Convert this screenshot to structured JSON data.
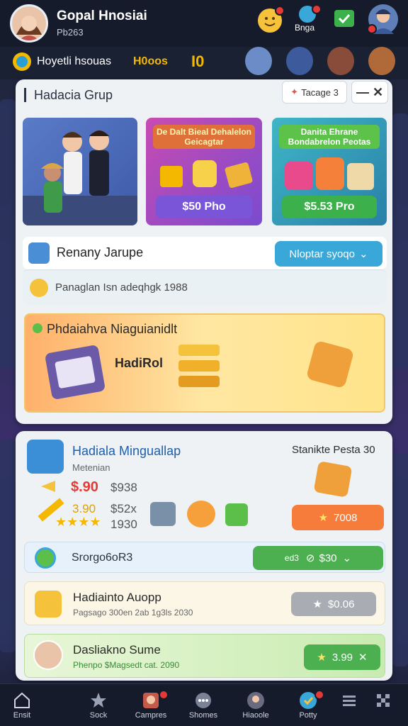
{
  "header": {
    "title": "Gopal Hnosiai",
    "subtitle": "Pb263",
    "icons": [
      {
        "name": "emoji-icon",
        "label": ""
      },
      {
        "name": "bell-icon",
        "label": "Bnga"
      },
      {
        "name": "ticket-icon",
        "label": ""
      },
      {
        "name": "user-icon",
        "label": ""
      }
    ]
  },
  "subbar": {
    "name": "Hoyetli hsouas",
    "coins": "H0oos",
    "count": "I0"
  },
  "panel1": {
    "title": "Hadacia Grup",
    "tab": "Tacage 3",
    "cards": [
      {
        "title": "",
        "button": ""
      },
      {
        "title": "De Dalt Bieal Dehalelon Geicagtar",
        "button": "$50 Pho"
      },
      {
        "title": "Danita Ehrane Bondabrelon Peotas",
        "button": "$5.53 Pro"
      }
    ],
    "row1": {
      "label": "Renany Jarupe",
      "button": "Nloptar syoqo"
    },
    "row2": {
      "label": "Panaglan Isn adeqhgk 1988"
    },
    "banner": {
      "title": "Phdaiahva Niaguianidlt",
      "label": "HadiRol"
    }
  },
  "panel2": {
    "title": "Hadiala Minguallap",
    "subtitle": "Metenian",
    "right_label": "Stanikte Pesta 30",
    "price_old": "$.90",
    "price_line1": "$938",
    "price_alt": "3.90",
    "price_line2": "$52x",
    "price_line3": "1930",
    "orange_btn": "7008",
    "row_a": {
      "label": "Srorgo6oR3",
      "small": "ed3",
      "button": "$30"
    },
    "row_b": {
      "title": "Hadiainto Auopp",
      "sub": "Pagsago 300en 2ab 1g3ls 2030",
      "button": "$0.06"
    },
    "row_c": {
      "title": "Dasliakno Sume",
      "sub": "Phenpo $Magsedt cat. 2090",
      "button": "3.99"
    }
  },
  "nav": [
    {
      "name": "home",
      "label": "Ensit"
    },
    {
      "name": "star",
      "label": "Sock"
    },
    {
      "name": "campaign",
      "label": "Campres"
    },
    {
      "name": "chat",
      "label": "Shomes"
    },
    {
      "name": "profile",
      "label": "Hiaoole"
    },
    {
      "name": "globe",
      "label": "Potty"
    },
    {
      "name": "menu",
      "label": ""
    },
    {
      "name": "grid",
      "label": ""
    }
  ],
  "colors": {
    "accent": "#f5b800",
    "green": "#4caf50",
    "orange": "#f57c3a",
    "blue": "#3aa7d9",
    "purple": "#7a4bd0"
  }
}
